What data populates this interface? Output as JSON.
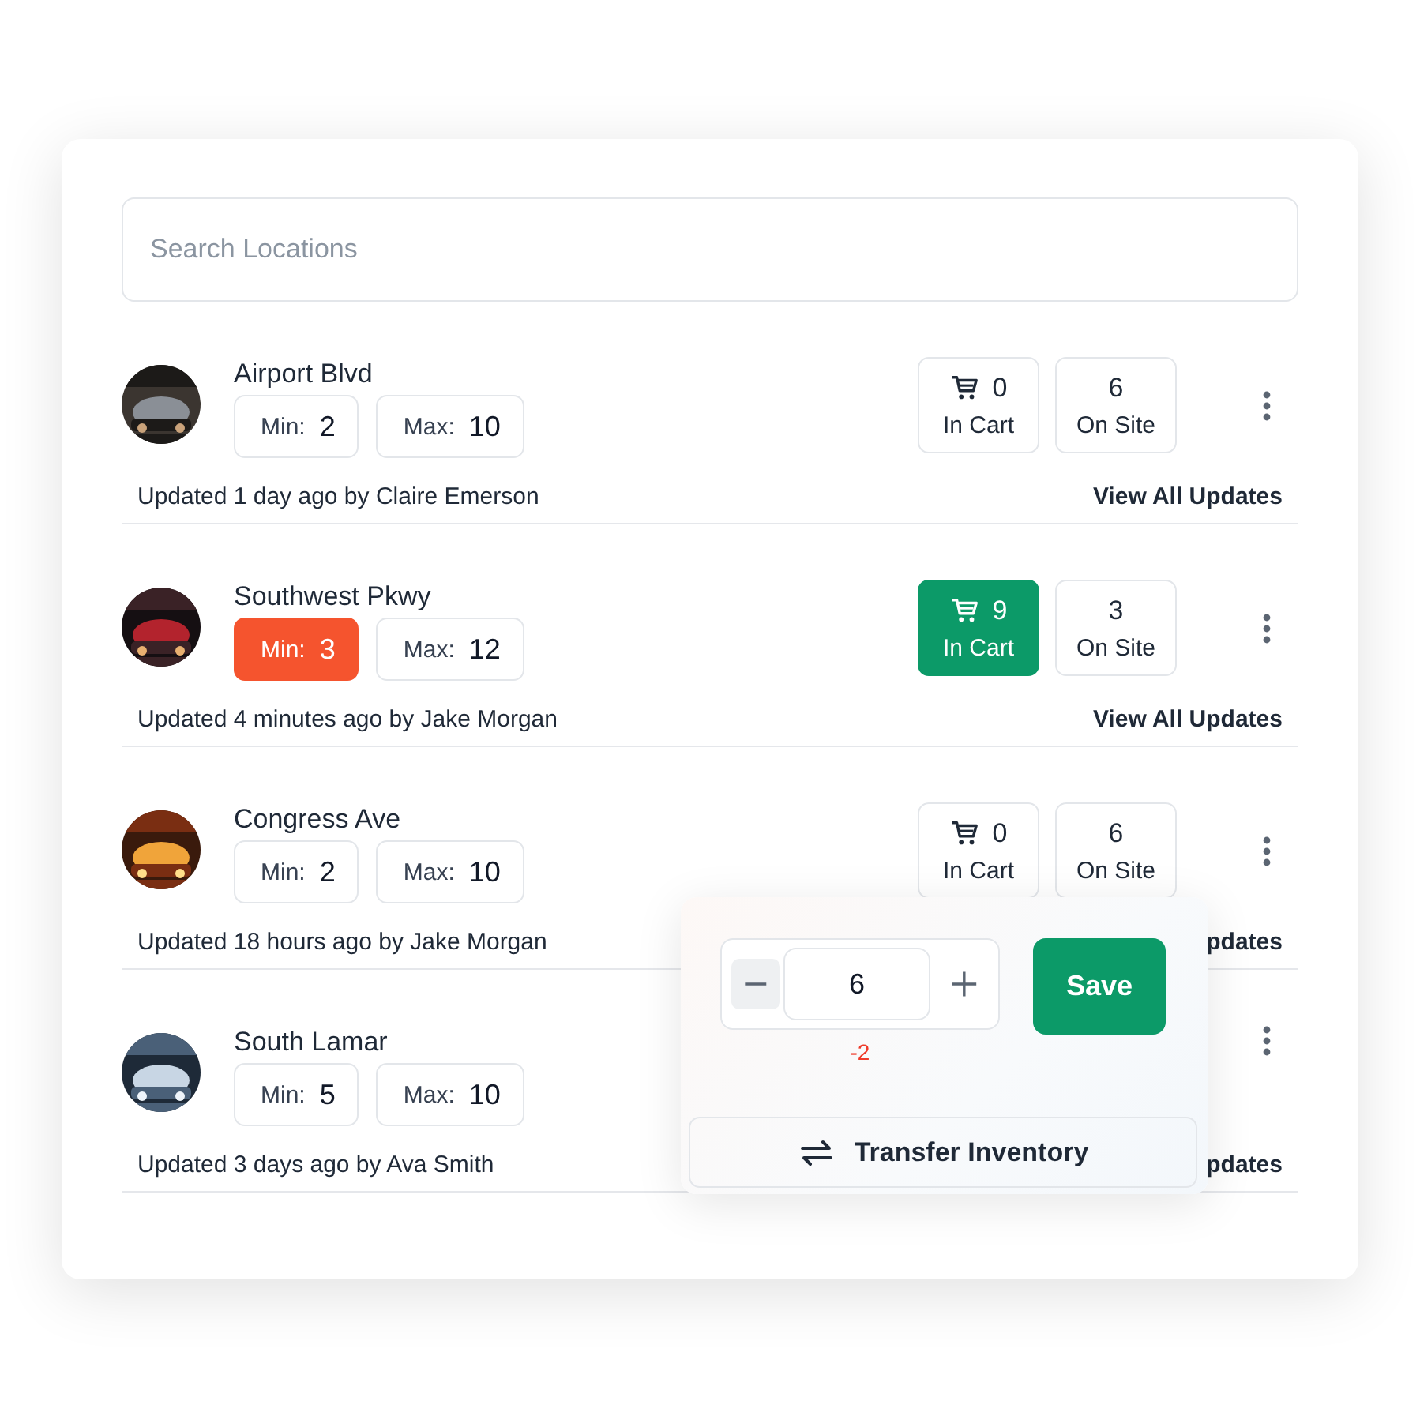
{
  "search": {
    "placeholder": "Search Locations"
  },
  "locations": [
    {
      "name": "Airport Blvd",
      "min": {
        "label": "Min:",
        "value": "2",
        "alert": false
      },
      "max": {
        "label": "Max:",
        "value": "10"
      },
      "in_cart": {
        "value": "0",
        "label": "In Cart",
        "highlighted": false
      },
      "on_site": {
        "value": "6",
        "label": "On Site"
      },
      "updated": "Updated 1 day ago by Claire Emerson",
      "link": "View All Updates"
    },
    {
      "name": "Southwest Pkwy",
      "min": {
        "label": "Min:",
        "value": "3",
        "alert": true
      },
      "max": {
        "label": "Max:",
        "value": "12"
      },
      "in_cart": {
        "value": "9",
        "label": "In Cart",
        "highlighted": true
      },
      "on_site": {
        "value": "3",
        "label": "On Site"
      },
      "updated": "Updated 4 minutes ago by Jake Morgan",
      "link": "View All Updates"
    },
    {
      "name": "Congress Ave",
      "min": {
        "label": "Min:",
        "value": "2",
        "alert": false
      },
      "max": {
        "label": "Max:",
        "value": "10"
      },
      "in_cart": {
        "value": "0",
        "label": "In Cart",
        "highlighted": false
      },
      "on_site": {
        "value": "6",
        "label": "On Site"
      },
      "updated": "Updated 18 hours ago by Jake Morgan",
      "link": "pdates",
      "popover": {
        "quantity": "6",
        "delta": "-2",
        "save": "Save",
        "transfer": "Transfer Inventory"
      }
    },
    {
      "name": "South Lamar",
      "min": {
        "label": "Min:",
        "value": "5",
        "alert": false
      },
      "max": {
        "label": "Max:",
        "value": "10"
      },
      "updated": "Updated 3 days ago by Ava Smith",
      "link": "pdates"
    }
  ]
}
